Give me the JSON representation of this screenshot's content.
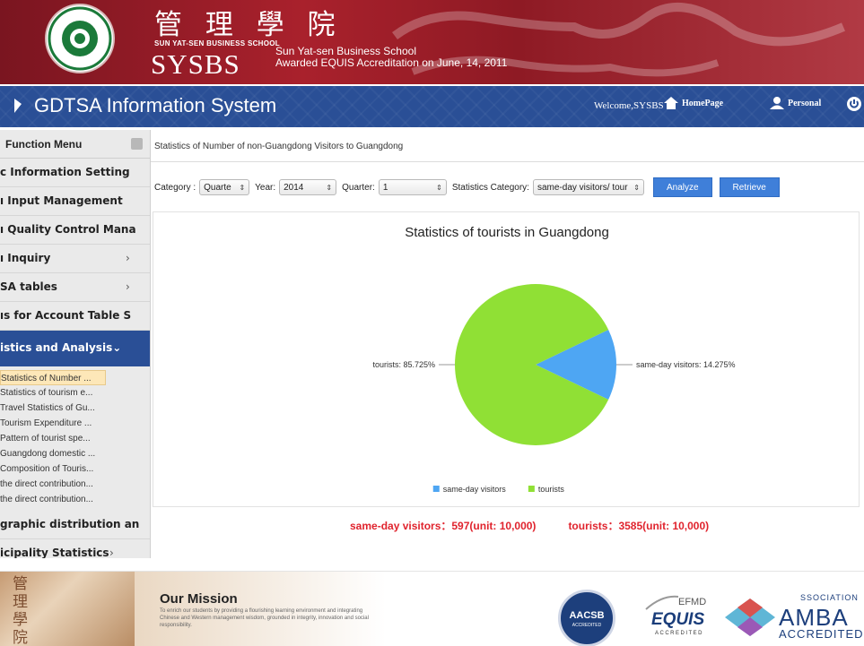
{
  "banner": {
    "cn_name": "管 理 學 院",
    "school_en": "SUN YAT-SEN BUSINESS SCHOOL",
    "abbr": "SYSBS",
    "line1": "Sun Yat-sen Business School",
    "line2": "Awarded EQUIS Accreditation on June, 14, 2011"
  },
  "nav": {
    "title": "GDTSA Information System",
    "welcome": "Welcome,SYSBS",
    "home": "HomePage",
    "personal": "Personal"
  },
  "sidebar": {
    "header": "Function Menu",
    "items": [
      {
        "label": "c Information Setting",
        "arrow": ""
      },
      {
        "label": "ı Input Management",
        "arrow": ""
      },
      {
        "label": "ı Quality Control Mana",
        "arrow": ""
      },
      {
        "label": "ı Inquiry",
        "arrow": "›"
      },
      {
        "label": "SA tables",
        "arrow": "›"
      },
      {
        "label": "ıs for Account Table S",
        "arrow": ""
      }
    ],
    "active": "istics and Analysis⌄",
    "sub_items": [
      "Statistics of Number ...",
      "Statistics of tourism e...",
      "Travel Statistics of Gu...",
      "Tourism Expenditure ...",
      "Pattern of tourist spe...",
      "Guangdong domestic ...",
      "Composition of Touris...",
      "the direct contribution...",
      "the direct contribution..."
    ],
    "after": [
      {
        "label": "graphic distribution an",
        "arrow": ""
      },
      {
        "label": "icipality Statistics",
        "arrow": "›"
      }
    ]
  },
  "main": {
    "breadcrumb": "Statistics of Number of non-Guangdong Visitors to Guangdong",
    "filters": {
      "category_label": "Category :",
      "category_value": "Quarte",
      "year_label": "Year:",
      "year_value": "2014",
      "quarter_label": "Quarter:",
      "quarter_value": "1",
      "stat_label": "Statistics Category:",
      "stat_value": "same-day visitors/ tour"
    },
    "buttons": {
      "analyze": "Analyze",
      "retrieve": "Retrieve"
    },
    "totals": {
      "sameday": "same-day visitors：597(unit: 10,000)",
      "tourists": "tourists：3585(unit: 10,000)"
    }
  },
  "chart_data": {
    "type": "pie",
    "title": "Statistics of tourists in Guangdong",
    "slices": [
      {
        "name": "same-day visitors",
        "value": 14.275,
        "label": "same-day visitors: 14.275%",
        "color": "#4ea6f3"
      },
      {
        "name": "tourists",
        "value": 85.725,
        "label": "tourists: 85.725%",
        "color": "#90e035"
      }
    ],
    "legend": [
      "same-day visitors",
      "tourists"
    ],
    "legend_position": "bottom"
  },
  "footer": {
    "mission_title": "Our Mission",
    "mission_text": "To enrich our students by providing a flourishing learning environment and integrating Chinese and Western management wisdom, grounded in integrity, innovation and social responsibility.",
    "aacsb": "AACSB",
    "aacsb_sub": "ACCREDITED",
    "efmd": "EFMD",
    "equis": "EQUIS",
    "equis_sub": "ACCREDITED",
    "amba_assoc": "SSOCIATION",
    "amba": "AMBA",
    "amba_sub": "ACCREDITED",
    "photo_chars": "管\n理\n學\n院"
  }
}
